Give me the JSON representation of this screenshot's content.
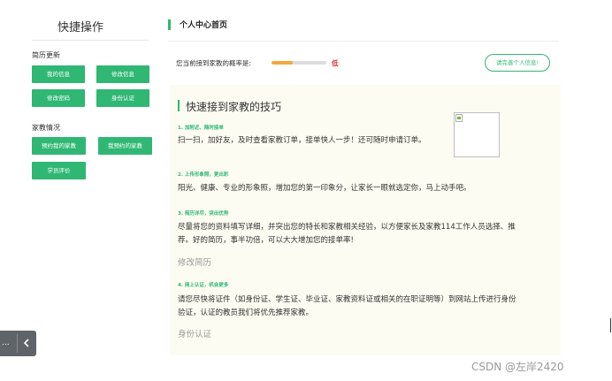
{
  "sidebar": {
    "title": "快捷操作",
    "resume_section": "简历更新",
    "resume_buttons": [
      "我的信息",
      "修改信息",
      "修改密码",
      "身份认证"
    ],
    "tutor_section": "家教情况",
    "tutor_buttons": [
      "预约我的家教",
      "我预约的家教",
      "学员评价"
    ],
    "collapse_dots": "...",
    "collapse_icon": "chevron-left-icon"
  },
  "main": {
    "title": "个人中心首页",
    "probability_label": "您当前接到家教的概率是:",
    "probability_fraction": 0.38,
    "probability_level": "低",
    "improve_button": "请完善个人信息!",
    "accent_color": "#2fb773"
  },
  "tips": {
    "title": "快速接到家教的技巧",
    "items": [
      {
        "heading": "1. 加附近、随时接单",
        "body": "扫一扫，加好友，及时查看家教订单，接单快人一步！还可随时申请订单。",
        "link": ""
      },
      {
        "heading": "2. 上传形象照，更出彩",
        "body": "阳光、健康、专业的形象照，增加您的第一印象分，让家长一眼就选定你，马上动手吧。",
        "link": ""
      },
      {
        "heading": "3. 简历详尽，突出优势",
        "body_lines": [
          "尽量将您的资料填写详细，并突出您的特长和家教相关经验，以方便家长及家教114工作人员选择、推",
          "荐。好的简历，事半功倍，可以大大增加您的接单率!"
        ],
        "link": "修改简历"
      },
      {
        "heading": "4. 网上认证，机会更多",
        "body_lines": [
          "请您尽快将证件（如身份证、学生证、毕业证、家教资料证或相关的在职证明等）到网站上传进行身份",
          "验证，认证的教员我们将优先推荐家教。"
        ],
        "link": "身份认证"
      }
    ]
  },
  "watermark": "CSDN @左岸2420"
}
